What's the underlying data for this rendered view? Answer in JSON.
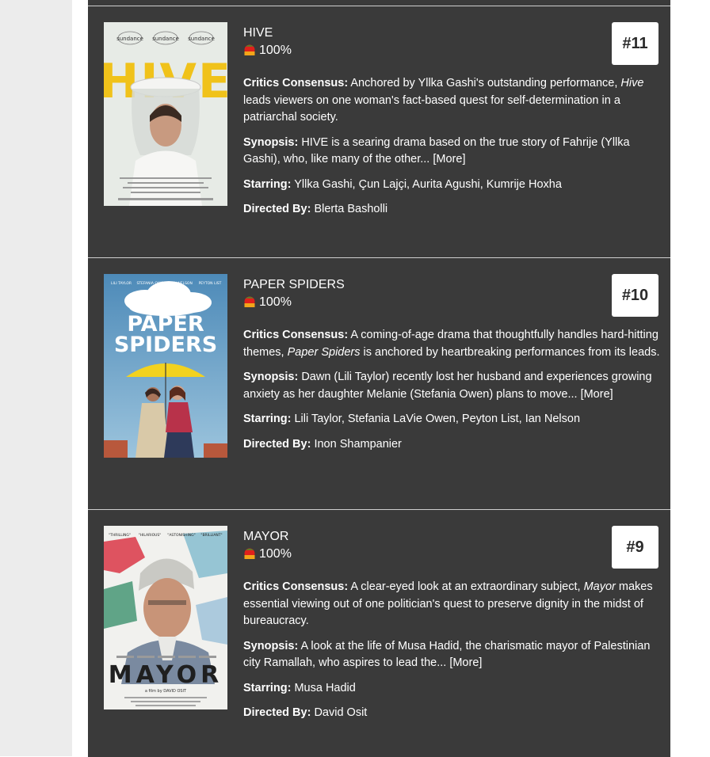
{
  "movies": [
    {
      "title": "HIVE",
      "score": "100%",
      "rank": "#11",
      "consensus_label": "Critics Consensus:",
      "consensus_pre": "Anchored by Yllka Gashi's outstanding performance, ",
      "consensus_em": "Hive",
      "consensus_post": " leads viewers on one woman's fact-based quest for self-determination in a patriarchal society.",
      "synopsis_label": "Synopsis:",
      "synopsis": "HIVE is a searing drama based on the true story of Fahrije (Yllka Gashi), who, like many of the other... ",
      "more": "[More]",
      "starring_label": "Starring:",
      "starring": "Yllka Gashi, Çun Lajçi, Aurita Agushi, Kumrije Hoxha",
      "directed_label": "Directed By:",
      "directed": "Blerta Basholli",
      "poster": {
        "title": "HIVE",
        "badges": [
          "sundance",
          "sundance",
          "sundance"
        ]
      }
    },
    {
      "title": "PAPER SPIDERS",
      "score": "100%",
      "rank": "#10",
      "consensus_label": "Critics Consensus:",
      "consensus_pre": "A coming-of-age drama that thoughtfully handles hard-hitting themes, ",
      "consensus_em": "Paper Spiders",
      "consensus_post": " is anchored by heartbreaking performances from its leads.",
      "synopsis_label": "Synopsis:",
      "synopsis": "Dawn (Lili Taylor) recently lost her husband and experiences growing anxiety as her daughter Melanie (Stefania Owen) plans to move... ",
      "more": "[More]",
      "starring_label": "Starring:",
      "starring": "Lili Taylor, Stefania LaVie Owen, Peyton List, Ian Nelson",
      "directed_label": "Directed By:",
      "directed": "Inon Shampanier",
      "poster": {
        "title_line1": "PAPER",
        "title_line2": "SPIDERS",
        "names": [
          "LILI TAYLOR",
          "STEFANIA OWEN",
          "IAN NELSON",
          "PEYTON LIST"
        ]
      }
    },
    {
      "title": "MAYOR",
      "score": "100%",
      "rank": "#9",
      "consensus_label": "Critics Consensus:",
      "consensus_pre": "A clear-eyed look at an extraordinary subject, ",
      "consensus_em": "Mayor",
      "consensus_post": " makes essential viewing out of one politician's quest to preserve dignity in the midst of bureaucracy.",
      "synopsis_label": "Synopsis:",
      "synopsis": "A look at the life of Musa Hadid, the charismatic mayor of Palestinian city Ramallah, who aspires to lead the... ",
      "more": "[More]",
      "starring_label": "Starring:",
      "starring": "Musa Hadid",
      "directed_label": "Directed By:",
      "directed": "David Osit",
      "poster": {
        "title": "MAYOR",
        "quotes": [
          "\"THRILLING\"",
          "\"HILARIOUS\"",
          "\"ASTONISHING\"",
          "\"BRILLIANT\""
        ],
        "credit": "a film by DAVID OSIT"
      }
    }
  ],
  "colors": {
    "card_bg": "#3a3a3a",
    "gutter": "#ececec",
    "rank_bg": "#ffffff",
    "tomato_red": "#e0201b",
    "tomato_green": "#2f9e2f"
  }
}
